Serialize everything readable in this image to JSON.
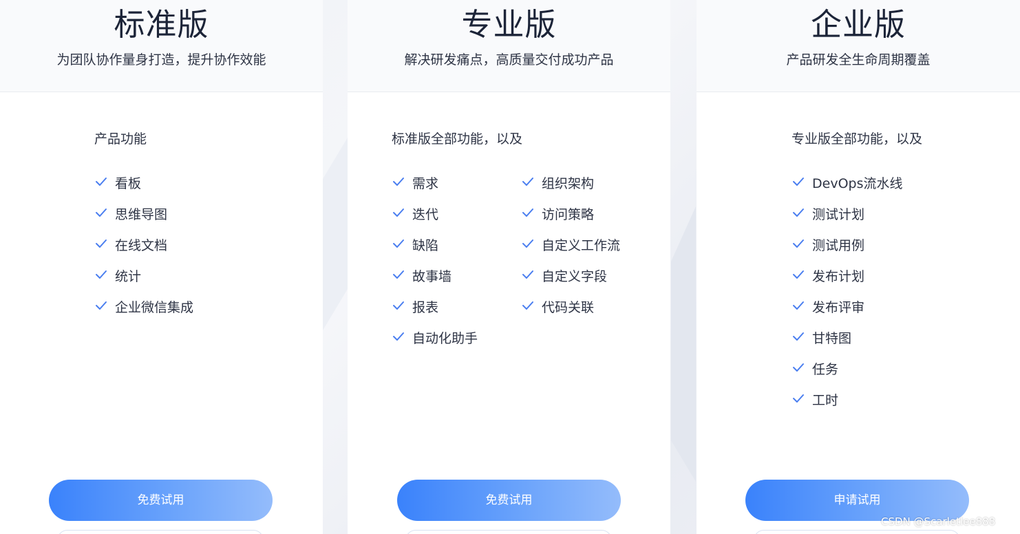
{
  "colors": {
    "accent": "#3a82fb",
    "check": "#4a7ef0",
    "title": "#1c2438",
    "text": "#2e3445",
    "header_bg": "#f9fafc"
  },
  "plans": [
    {
      "title": "标准版",
      "subtitle": "为团队协作量身打造，提升协作效能",
      "features_heading": "产品功能",
      "features": [
        "看板",
        "思维导图",
        "在线文档",
        "统计",
        "企业微信集成"
      ],
      "features_col2": [],
      "button_label": "免费试用"
    },
    {
      "title": "专业版",
      "subtitle": "解决研发痛点，高质量交付成功产品",
      "features_heading": "标准版全部功能，以及",
      "features": [
        "需求",
        "迭代",
        "缺陷",
        "故事墙",
        "报表",
        "自动化助手"
      ],
      "features_col2": [
        "组织架构",
        "访问策略",
        "自定义工作流",
        "自定义字段",
        "代码关联"
      ],
      "button_label": "免费试用"
    },
    {
      "title": "企业版",
      "subtitle": "产品研发全生命周期覆盖",
      "features_heading": "专业版全部功能，以及",
      "features": [
        "DevOps流水线",
        "测试计划",
        "测试用例",
        "发布计划",
        "发布评审",
        "甘特图",
        "任务",
        "工时"
      ],
      "features_col2": [],
      "button_label": "申请试用"
    }
  ],
  "icons": {
    "feature_check": "check-icon"
  },
  "watermark": "CSDN @Scarletlee888"
}
